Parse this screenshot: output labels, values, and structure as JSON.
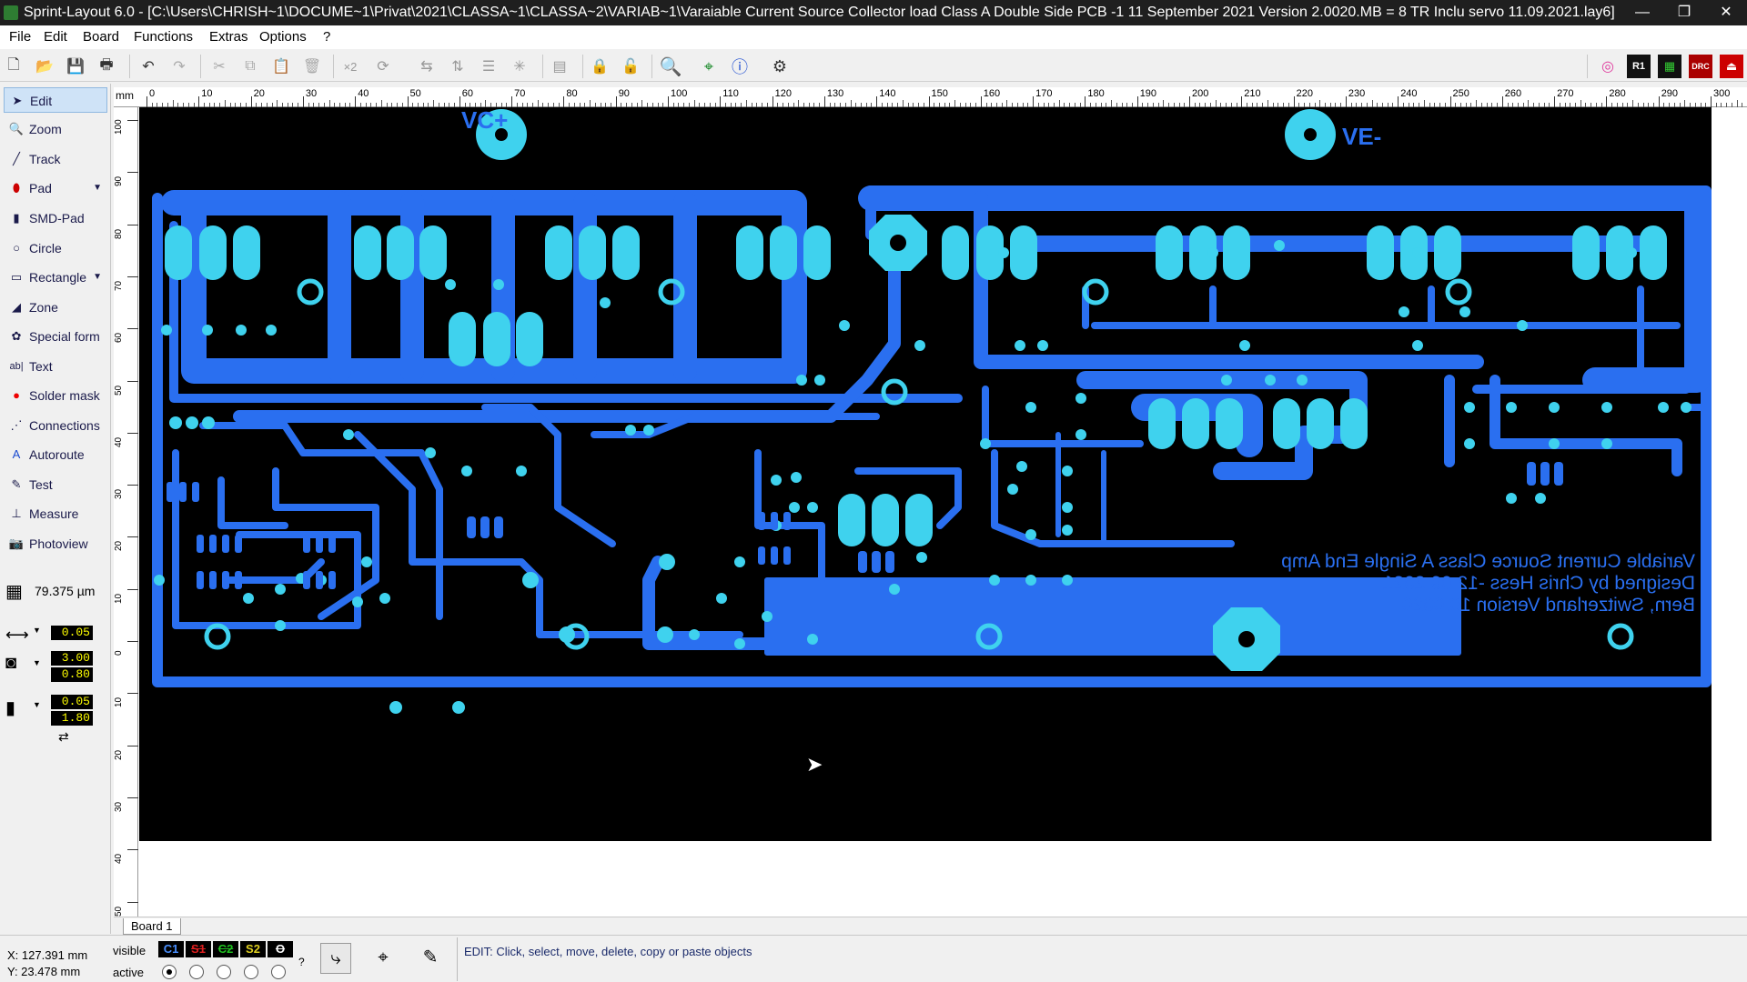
{
  "window": {
    "title": "Sprint-Layout 6.0 - [C:\\Users\\CHRISH~1\\DOCUME~1\\Privat\\2021\\CLASSA~1\\CLASSA~2\\VARIAB~1\\Varaiable Current Source Collector load Class A Double Side PCB -1 11 September 2021 Version 2.0020.MB = 8 TR Inclu servo 11.09.2021.lay6]",
    "minimize": "—",
    "restore": "❐",
    "close": "✕"
  },
  "menu": [
    "File",
    "Edit",
    "Board",
    "Functions",
    "Extras",
    "Options",
    "?"
  ],
  "toolbar": {
    "buttons": [
      "new-icon",
      "open-icon",
      "save-icon",
      "print-icon",
      "undo-icon",
      "redo-icon",
      "cut-icon",
      "copy-icon",
      "paste-icon",
      "delete-icon",
      "duplicate-icon",
      "rotate-icon",
      "mirror-h-icon",
      "mirror-v-icon",
      "align-icon",
      "center-icon",
      "group-icon",
      "lock-icon",
      "unlock-icon",
      "zoom-icon",
      "snap-icon",
      "info-icon",
      "settings-icon"
    ],
    "right_buttons": [
      "pad-icon",
      "r1-icon",
      "qr-icon",
      "drc-icon",
      "exit-icon"
    ],
    "label_x2": "×2",
    "label_r1": "R1",
    "label_drc": "DRC"
  },
  "tools": [
    {
      "label": "Edit",
      "icon": "cursor-icon",
      "active": true
    },
    {
      "label": "Zoom",
      "icon": "magnifier-icon"
    },
    {
      "label": "Track",
      "icon": "track-icon"
    },
    {
      "label": "Pad",
      "icon": "pad-icon",
      "dropdown": true
    },
    {
      "label": "SMD-Pad",
      "icon": "smd-pad-icon"
    },
    {
      "label": "Circle",
      "icon": "circle-icon"
    },
    {
      "label": "Rectangle",
      "icon": "rectangle-icon",
      "dropdown": true
    },
    {
      "label": "Zone",
      "icon": "zone-icon"
    },
    {
      "label": "Special form",
      "icon": "special-form-icon"
    },
    {
      "label": "Text",
      "icon": "text-icon"
    },
    {
      "label": "Solder mask",
      "icon": "solder-mask-icon"
    },
    {
      "label": "Connections",
      "icon": "connections-icon"
    },
    {
      "label": "Autoroute",
      "icon": "autoroute-icon"
    },
    {
      "label": "Test",
      "icon": "test-icon"
    },
    {
      "label": "Measure",
      "icon": "measure-icon"
    },
    {
      "label": "Photoview",
      "icon": "photoview-icon"
    }
  ],
  "grid": {
    "value": "79.375 µm"
  },
  "params": {
    "track_width": "0.05",
    "pad_outer": "3.00",
    "pad_inner": "0.80",
    "smd_w": "0.05",
    "smd_h": "1.80"
  },
  "ruler": {
    "unit": "mm",
    "top_labels": [
      "0",
      "10",
      "20",
      "30",
      "40",
      "50",
      "60",
      "70",
      "80",
      "90",
      "100",
      "110",
      "120",
      "130",
      "140",
      "150",
      "160",
      "170",
      "180",
      "190",
      "200",
      "210",
      "220",
      "230",
      "240",
      "250",
      "260",
      "270",
      "280",
      "290",
      "300"
    ],
    "left_labels": [
      "100",
      "90",
      "80",
      "70",
      "60",
      "50",
      "40",
      "30",
      "20",
      "10",
      "0",
      "10",
      "20",
      "30",
      "40",
      "50"
    ]
  },
  "board": {
    "labels": {
      "vc_plus": "VC+",
      "ve_minus": "VE-"
    },
    "mirrored_text": [
      "Variable Current Source Class A Single End Amp",
      "Designed by Chris Hess -12.09.2021",
      "Bern, Switzerland  Version 10.0020"
    ]
  },
  "tabs": {
    "board1": "Board 1"
  },
  "status": {
    "x": "X:  127.391 mm",
    "y": "Y:   23.478 mm",
    "visible": "visible",
    "active": "active",
    "layers": [
      "C1",
      "S1",
      "C2",
      "S2",
      "O"
    ],
    "question": "?",
    "message": "EDIT:  Click, select, move, delete, copy or paste objects"
  },
  "colors": {
    "copper": "#2a6ff0",
    "pad": "#3fd2ee",
    "board_bg": "#000000"
  }
}
